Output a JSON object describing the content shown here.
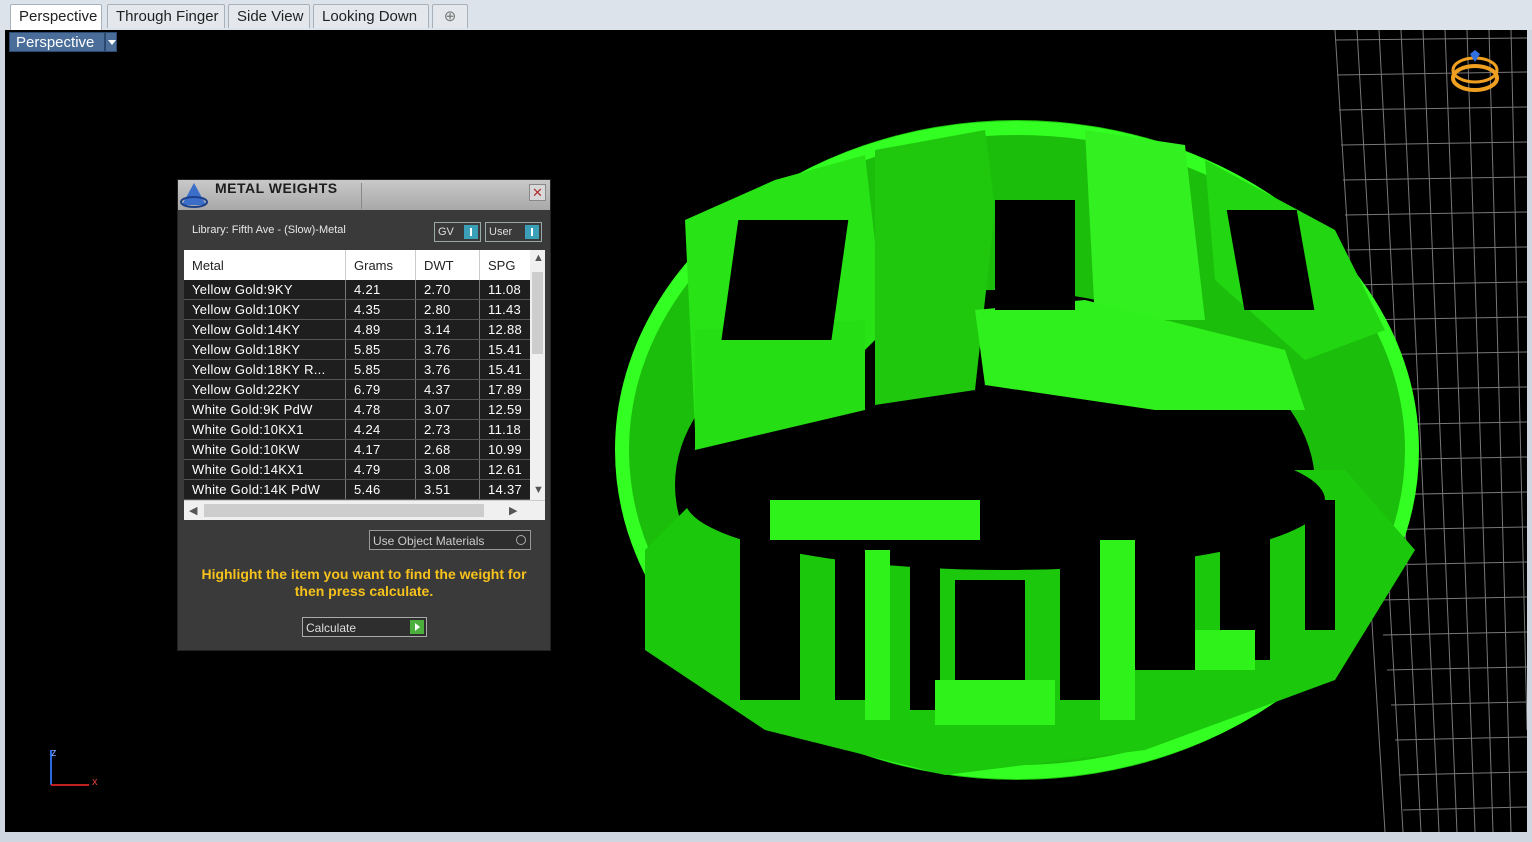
{
  "tabs": [
    {
      "label": "Perspective",
      "active": true
    },
    {
      "label": "Through Finger",
      "active": false
    },
    {
      "label": "Side View",
      "active": false
    },
    {
      "label": "Looking Down",
      "active": false
    }
  ],
  "add_tab_icon": "plus-icon",
  "viewport": {
    "label": "Perspective",
    "axis": {
      "z": "z",
      "x": "x"
    },
    "model_color": "#22dd11",
    "background": "#000000"
  },
  "panel": {
    "title": "METAL WEIGHTS",
    "close_label": "✕",
    "library": "Library: Fifth Ave - (Slow)-Metal",
    "toggle_gv": "GV",
    "toggle_user": "User",
    "columns": [
      "Metal",
      "Grams",
      "DWT",
      "SPG"
    ],
    "rows": [
      [
        "Yellow Gold:9KY",
        "4.21",
        "2.70",
        "11.08"
      ],
      [
        "Yellow Gold:10KY",
        "4.35",
        "2.80",
        "11.43"
      ],
      [
        "Yellow Gold:14KY",
        "4.89",
        "3.14",
        "12.88"
      ],
      [
        "Yellow Gold:18KY",
        "5.85",
        "3.76",
        "15.41"
      ],
      [
        "Yellow Gold:18KY R...",
        "5.85",
        "3.76",
        "15.41"
      ],
      [
        "Yellow Gold:22KY",
        "6.79",
        "4.37",
        "17.89"
      ],
      [
        "White Gold:9K PdW",
        "4.78",
        "3.07",
        "12.59"
      ],
      [
        "White Gold:10KX1",
        "4.24",
        "2.73",
        "11.18"
      ],
      [
        "White Gold:10KW",
        "4.17",
        "2.68",
        "10.99"
      ],
      [
        "White Gold:14KX1",
        "4.79",
        "3.08",
        "12.61"
      ],
      [
        "White Gold:14K PdW",
        "5.46",
        "3.51",
        "14.37"
      ]
    ],
    "use_object_materials": "Use Object Materials",
    "hint": "Highlight the item you want to find the weight for then press calculate.",
    "calculate_label": "Calculate",
    "accent": "#f6c21b"
  }
}
